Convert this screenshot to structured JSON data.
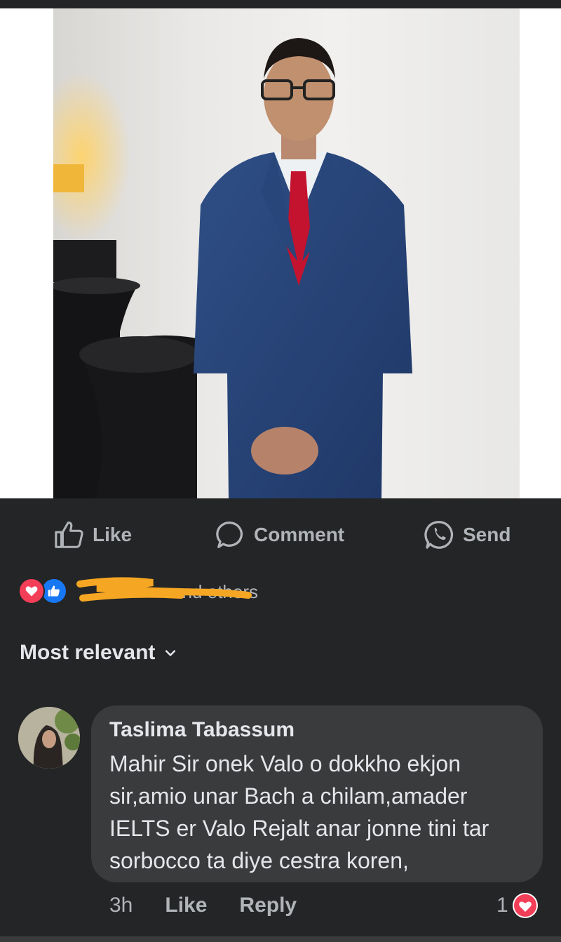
{
  "post": {
    "photo_alt": "Young man in a navy suit and red tie"
  },
  "actions": {
    "like_label": "Like",
    "comment_label": "Comment",
    "send_label": "Send"
  },
  "reactions": {
    "summary_text": "and others",
    "icons": [
      "love-reaction",
      "like-reaction"
    ],
    "redaction_color": "#f5a623"
  },
  "comments_filter": {
    "label": "Most relevant"
  },
  "comment": {
    "author": "Taslima Tabassum",
    "text": "Mahir Sir onek Valo o dokkho ekjon sir,amio unar Bach a chilam,amader IELTS er Valo Rejalt anar jonne tini tar sorbocco ta diye cestra koren,",
    "time": "3h",
    "like_label": "Like",
    "reply_label": "Reply",
    "reaction_count": "1"
  },
  "colors": {
    "background": "#242526",
    "bubble": "#3a3b3c",
    "text_primary": "#e4e6eb",
    "text_secondary": "#b0b3b8",
    "love": "#f33e58",
    "like_blue": "#1877f2"
  }
}
